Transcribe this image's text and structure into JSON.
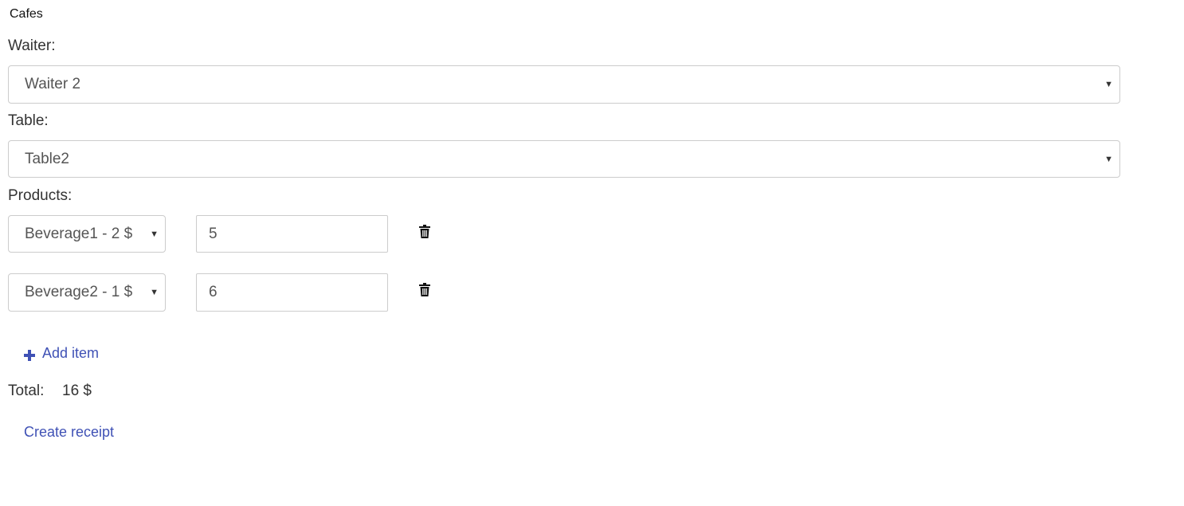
{
  "app": {
    "title": "Cafes"
  },
  "form": {
    "waiter_label": "Waiter:",
    "waiter_selected": "Waiter 2",
    "table_label": "Table:",
    "table_selected": "Table2",
    "products_label": "Products:"
  },
  "products": [
    {
      "product": "Beverage1 - 2 $",
      "quantity": "5"
    },
    {
      "product": "Beverage2 - 1 $",
      "quantity": "6"
    }
  ],
  "actions": {
    "add_item_label": "Add item",
    "create_receipt_label": "Create receipt"
  },
  "summary": {
    "total_label": "Total:",
    "total_value": "16 $"
  },
  "icons": {
    "delete": "trash-icon",
    "add": "plus-icon",
    "dropdown": "caret-down-icon"
  },
  "colors": {
    "link": "#3f51b5",
    "text": "#333333",
    "border": "#cccccc"
  }
}
